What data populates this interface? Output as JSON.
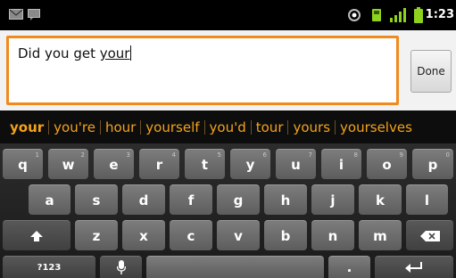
{
  "status_bar": {
    "time": "1:23",
    "icons": [
      "mail-icon",
      "message-icon",
      "gps-icon",
      "sd-icon",
      "signal-icon",
      "battery-icon"
    ]
  },
  "editor": {
    "typed_text": "Did you get ",
    "composing_text": "your",
    "done_label": "Done"
  },
  "suggestions": [
    "your",
    "you're",
    "hour",
    "yourself",
    "you'd",
    "tour",
    "yours",
    "yourselves"
  ],
  "keyboard": {
    "row1": [
      {
        "label": "q",
        "hint": "1"
      },
      {
        "label": "w",
        "hint": "2"
      },
      {
        "label": "e",
        "hint": "3"
      },
      {
        "label": "r",
        "hint": "4"
      },
      {
        "label": "t",
        "hint": "5"
      },
      {
        "label": "y",
        "hint": "6"
      },
      {
        "label": "u",
        "hint": "7"
      },
      {
        "label": "i",
        "hint": "8"
      },
      {
        "label": "o",
        "hint": "9"
      },
      {
        "label": "p",
        "hint": "0"
      }
    ],
    "row2": [
      "a",
      "s",
      "d",
      "f",
      "g",
      "h",
      "j",
      "k",
      "l"
    ],
    "row3": [
      "z",
      "x",
      "c",
      "v",
      "b",
      "n",
      "m"
    ],
    "symbols_label": "?123",
    "period_label": "."
  },
  "colors": {
    "accent": "#f08a1e",
    "suggestion_text": "#f3a31c",
    "key_bg": "#6a6a6a"
  }
}
